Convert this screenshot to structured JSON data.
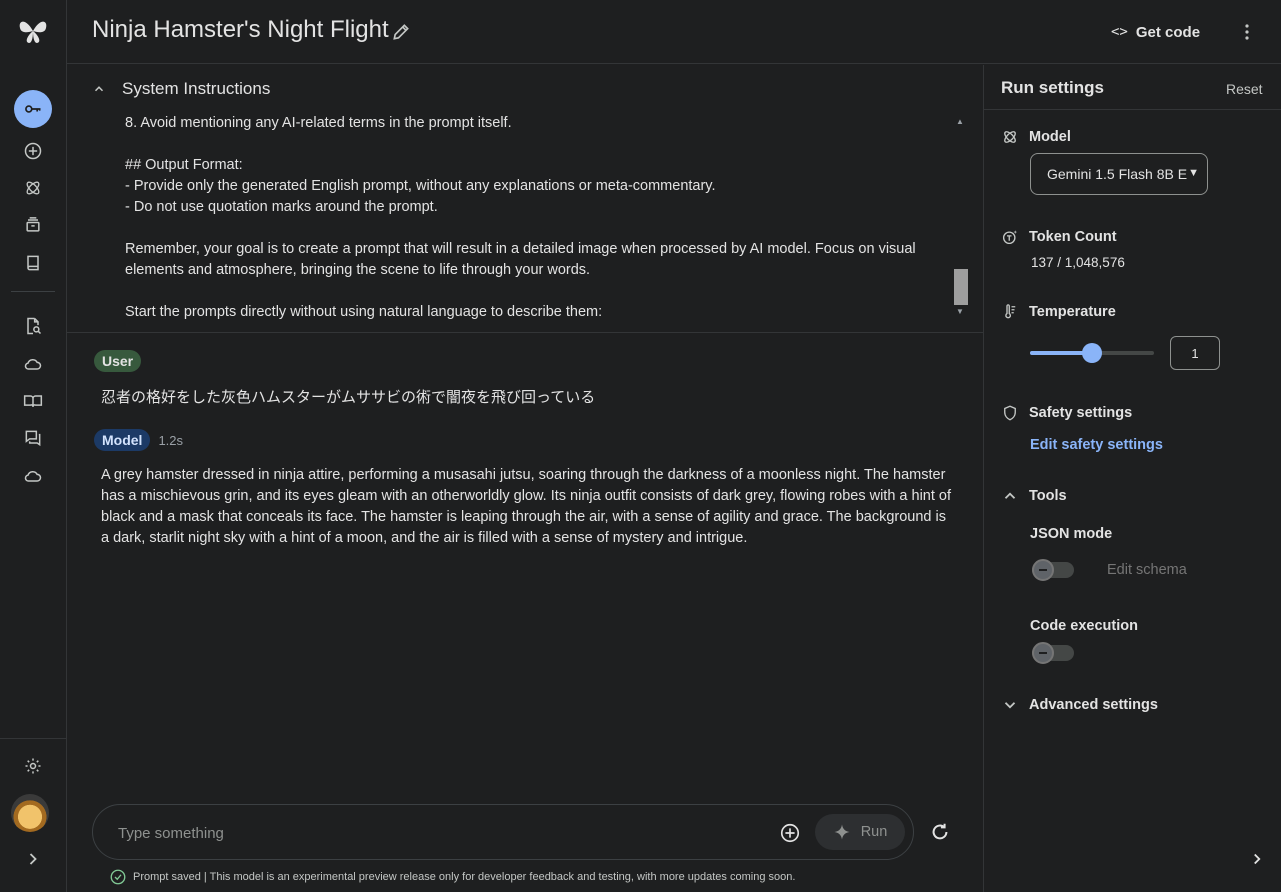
{
  "header": {
    "title": "Ninja Hamster's Night Flight",
    "get_code_icon": "<>",
    "get_code_label": "Get code"
  },
  "system_instructions": {
    "label": "System Instructions",
    "lines": [
      "8. Avoid mentioning any AI-related terms in the prompt itself.",
      "## Output Format:",
      "- Provide only the generated English prompt, without any explanations or meta-commentary.",
      "- Do not use quotation marks around the prompt.",
      "Remember, your goal is to create a prompt that will result in a detailed image when processed by AI model. Focus on visual elements and atmosphere, bringing the scene to life through your words.",
      "Start the prompts directly without using natural language to describe them:"
    ]
  },
  "chat": {
    "user_role": "User",
    "user_message": "忍者の格好をした灰色ハムスターがムササビの術で闇夜を飛び回っている",
    "model_role": "Model",
    "model_time": "1.2s",
    "model_message": "A grey hamster dressed in ninja attire, performing a musasahi jutsu, soaring through the darkness of a moonless night. The hamster has a mischievous grin, and its eyes gleam with an otherworldly glow. Its ninja outfit consists of dark grey, flowing robes with a hint of black and a mask that conceals its face. The hamster is leaping through the air, with a sense of agility and grace. The background is a dark, starlit night sky with a hint of a moon, and the air is filled with a sense of mystery and intrigue."
  },
  "input": {
    "placeholder": "Type something",
    "run_label": "Run"
  },
  "footer": {
    "note": "Prompt saved | This model is an experimental preview release only for developer feedback and testing, with more updates coming soon."
  },
  "settings": {
    "title": "Run settings",
    "reset_label": "Reset",
    "model_label": "Model",
    "model_value": "Gemini 1.5 Flash 8B E",
    "token_label": "Token Count",
    "token_value": "137 / 1,048,576",
    "temperature_label": "Temperature",
    "temperature_value": "1",
    "temperature_fraction": 0.5,
    "safety_label": "Safety settings",
    "safety_link": "Edit safety settings",
    "tools_label": "Tools",
    "json_mode_label": "JSON mode",
    "edit_schema_label": "Edit schema",
    "code_execution_label": "Code execution",
    "advanced_label": "Advanced settings"
  },
  "colors": {
    "accent": "#8ab4f8",
    "background": "#1e1f20",
    "user_chip": "#37593d",
    "model_chip": "#1c3a66"
  }
}
